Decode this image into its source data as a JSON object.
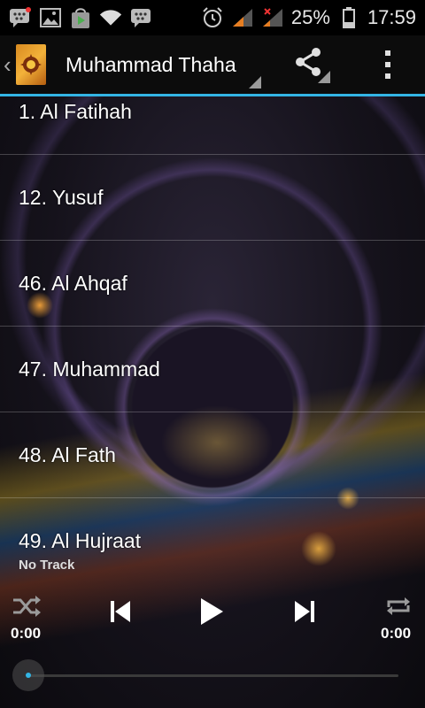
{
  "status_bar": {
    "battery_percent": "25%",
    "clock": "17:59",
    "icons": [
      "bbm-notification-icon",
      "gallery-icon",
      "play-store-icon",
      "wifi-icon",
      "bbm-icon",
      "alarm-icon",
      "signal-icon",
      "no-signal-icon",
      "battery-icon"
    ]
  },
  "action_bar": {
    "title": "Muhammad Thaha",
    "accent_color": "#33b5e5"
  },
  "tracks": [
    {
      "label": "1. Al Fatihah"
    },
    {
      "label": "12. Yusuf"
    },
    {
      "label": "46. Al Ahqaf"
    },
    {
      "label": "47. Muhammad"
    },
    {
      "label": "48. Al Fath"
    },
    {
      "label": "49. Al Hujraat"
    }
  ],
  "player": {
    "now_playing": "No Track",
    "elapsed": "0:00",
    "duration": "0:00",
    "progress": 0
  }
}
